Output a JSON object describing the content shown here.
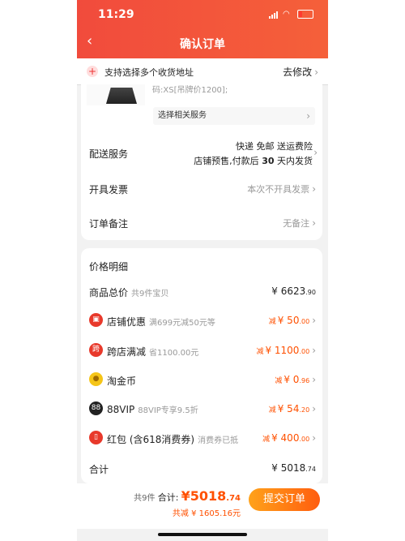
{
  "status_bar": {
    "time": "11:29"
  },
  "header": {
    "title": "确认订单"
  },
  "address_bar": {
    "text": "支持选择多个收货地址",
    "modify": "去修改"
  },
  "product": {
    "sku_text": "码:XS[吊牌价1200];",
    "service_text": "选择相关服务"
  },
  "delivery": {
    "label": "配送服务",
    "line1": "快递 免邮 送运费险",
    "line2_prefix": "店铺预售,付款后",
    "line2_days": "30",
    "line2_suffix": "天内发货"
  },
  "invoice": {
    "label": "开具发票",
    "value": "本次不开具发票"
  },
  "remark": {
    "label": "订单备注",
    "value": "无备注"
  },
  "price_detail": {
    "title": "价格明细",
    "goods_total": {
      "label": "商品总价",
      "note": "共9件宝贝",
      "value_int": "¥ 6623",
      "value_dec": ".90"
    },
    "items": [
      {
        "icon": "store-icon",
        "label": "店铺优惠",
        "note": "满699元减50元等",
        "prefix": "减",
        "value_int": "¥ 50",
        "value_dec": ".00",
        "color": "#e8392b"
      },
      {
        "icon": "cross-store-icon",
        "label": "跨店满减",
        "note": "省1100.00元",
        "prefix": "减",
        "value_int": "¥ 1100",
        "value_dec": ".00",
        "color": "#e8392b",
        "badge": "跨"
      },
      {
        "icon": "taojinbi-coin-icon",
        "label": "淘金币",
        "note": "",
        "prefix": "减",
        "value_int": "¥ 0",
        "value_dec": ".96",
        "color": "#f5c518"
      },
      {
        "icon": "88vip-icon",
        "label": "88VIP",
        "note": "88VIP专享9.5折",
        "prefix": "减",
        "value_int": "¥ 54",
        "value_dec": ".20",
        "color": "#222222",
        "badge": "88"
      },
      {
        "icon": "red-packet-icon",
        "label": "红包 (含618消费券)",
        "note": "消费券已抵",
        "prefix": "减",
        "value_int": "¥ 400",
        "value_dec": ".00",
        "color": "#e8392b"
      }
    ],
    "subtotal": {
      "label": "合计",
      "value_int": "¥ 5018",
      "value_dec": ".74"
    }
  },
  "footer": {
    "count": "共9件",
    "total_label": "合计:",
    "total_int": "¥5018",
    "total_dec": ".74",
    "saved": "共减 ¥ 1605.16元",
    "submit": "提交订单"
  },
  "colors": {
    "accent": "#f14b3c",
    "price": "#ff5000"
  }
}
